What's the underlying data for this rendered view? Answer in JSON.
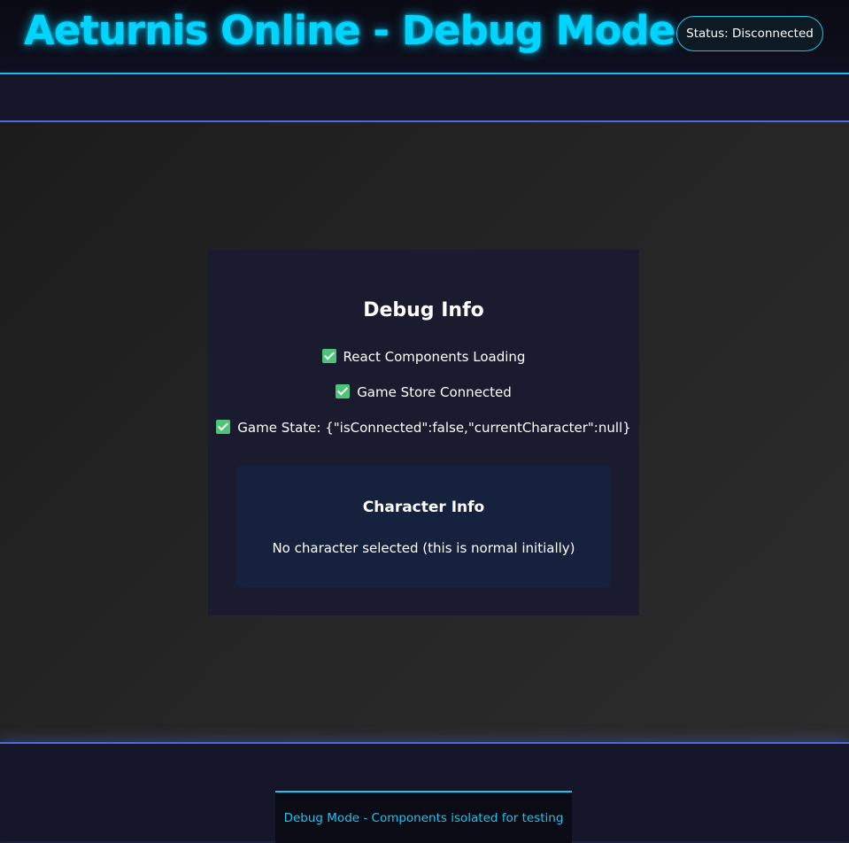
{
  "header": {
    "title": "Aeturnis Online - Debug Mode",
    "status": "Status: Disconnected"
  },
  "debug_panel": {
    "title": "Debug Info",
    "checks": [
      "React Components Loading",
      "Game Store Connected",
      "Game State: {\"isConnected\":false,\"currentCharacter\":null}"
    ],
    "check_icon": "check-mark-icon"
  },
  "character_info": {
    "title": "Character Info",
    "message": "No character selected (this is normal initially)"
  },
  "footer": {
    "note": "Debug Mode - Components isolated for testing"
  },
  "colors": {
    "accent_cyan": "#00d4ff",
    "accent_blue": "#4f6ae0",
    "check_green": "#4dc477",
    "panel_bg": "#1b1b2f",
    "card_bg": "#16213e"
  }
}
